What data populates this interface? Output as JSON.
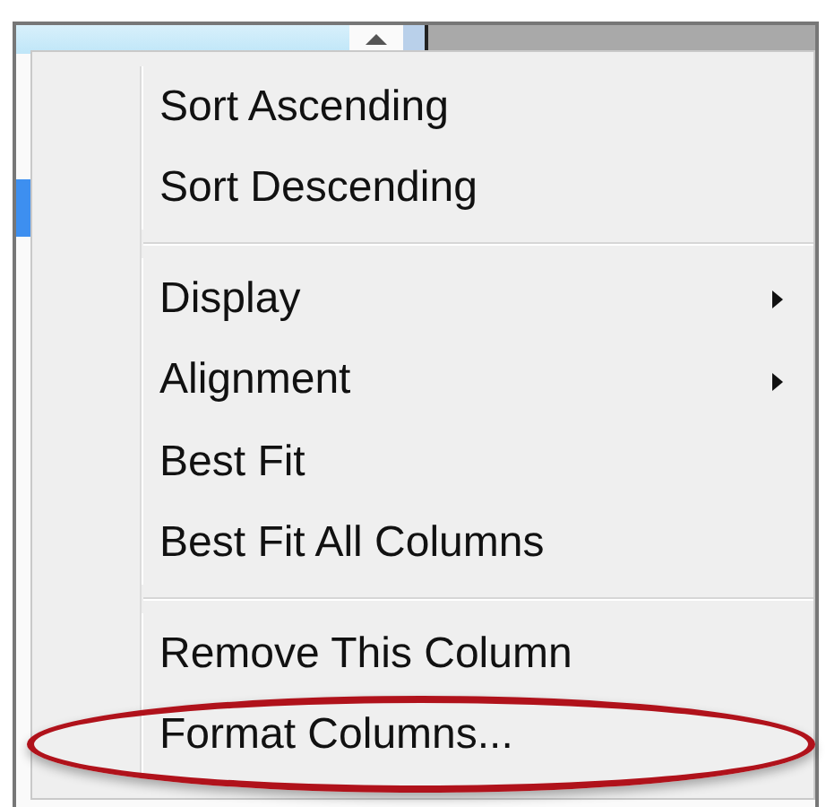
{
  "menu": {
    "items": [
      {
        "kind": "item",
        "label": "Sort Ascending",
        "submenu": false,
        "circled": false
      },
      {
        "kind": "item",
        "label": "Sort Descending",
        "submenu": false,
        "circled": false
      },
      {
        "kind": "separator"
      },
      {
        "kind": "item",
        "label": "Display",
        "submenu": true,
        "circled": false
      },
      {
        "kind": "item",
        "label": "Alignment",
        "submenu": true,
        "circled": false
      },
      {
        "kind": "item",
        "label": "Best Fit",
        "submenu": false,
        "circled": false
      },
      {
        "kind": "item",
        "label": "Best Fit All Columns",
        "submenu": false,
        "circled": false
      },
      {
        "kind": "separator"
      },
      {
        "kind": "item",
        "label": "Remove This Column",
        "submenu": false,
        "circled": false
      },
      {
        "kind": "item",
        "label": "Format Columns...",
        "submenu": false,
        "circled": true
      }
    ]
  }
}
